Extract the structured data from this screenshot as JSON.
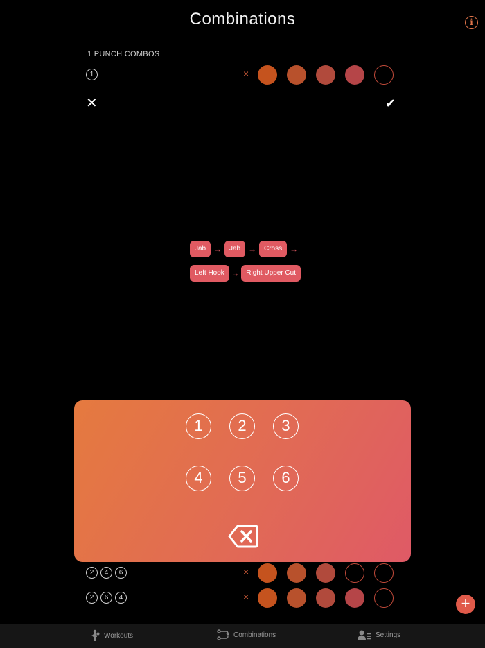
{
  "header": {
    "title": "Combinations",
    "info_glyph": "i"
  },
  "section": {
    "label": "1 PUNCH COMBOS"
  },
  "colors": {
    "accent": "#e0744a",
    "chip": "#e05a62",
    "dot_fill": [
      "#c5531e",
      "#b8512c",
      "#b14a3c",
      "#b54548"
    ],
    "empty_dot": "#c24a3a"
  },
  "combos": [
    {
      "nums": [
        "1"
      ],
      "delete": "×"
    },
    {
      "nums": [
        "2",
        "4",
        "6"
      ],
      "delete": "×"
    },
    {
      "nums": [
        "2",
        "6",
        "4"
      ],
      "delete": "×"
    }
  ],
  "overlay": {
    "cancel": "✕",
    "confirm": "✔",
    "chain_row1": [
      "Jab",
      "Jab",
      "Cross"
    ],
    "chain_row2": [
      "Left Hook",
      "Right Upper Cut"
    ],
    "arrow": "→"
  },
  "keypad": {
    "keys": [
      "1",
      "2",
      "3",
      "4",
      "5",
      "6"
    ],
    "backspace_icon": "backspace-icon"
  },
  "fab": {
    "label": "+"
  },
  "tabs": [
    {
      "label": "Workouts",
      "icon": "boxer-icon"
    },
    {
      "label": "Combinations",
      "icon": "combination-icon"
    },
    {
      "label": "Settings",
      "icon": "settings-profile-icon"
    }
  ]
}
